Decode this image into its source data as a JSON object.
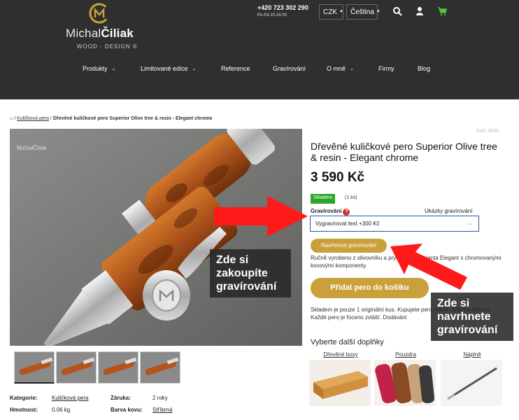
{
  "header": {
    "logo_first": "Michal",
    "logo_last": "Čiliak",
    "logo_sub": "WOOD - DESIGN ®",
    "phone": "+420 723 302 290",
    "hours": "Po-Pá 10-16:00",
    "currency": "CZK",
    "language": "Čeština",
    "nav": [
      {
        "label": "Produkty"
      },
      {
        "label": "Limitované edice"
      },
      {
        "label": "Reference"
      },
      {
        "label": "Gravírování"
      },
      {
        "label": "O mně"
      },
      {
        "label": "Firmy"
      },
      {
        "label": "Blog"
      }
    ]
  },
  "breadcrumb": {
    "category": "Kuličková pera",
    "separator": "/",
    "current": "Dřevěné kuličkové pero Superior Olive tree & resin - Elegant chrome"
  },
  "product": {
    "code": "Kód: 3633",
    "watermark": "MichalČiliak",
    "title": "Dřevěné kuličkové pero Superior Olive tree & resin - Elegant chrome",
    "price": "3 590 Kč",
    "stock_badge": "Skladem",
    "stock_qty": "(1 ks)",
    "engraving_label": "Gravírování",
    "engraving_help": "?",
    "engraving_preview_label": "Ukázky gravírování",
    "engraving_selected": "Vygravírovat text +300 Kč",
    "design_engraving_button": "Navrhnout gravírování",
    "description": "Ručně vyrobeno z olivovníku a pryskyřice - varianta Elegant s chromovanými kovovými komponenty.",
    "add_to_cart": "Přidat pero do košíku",
    "stock_note": "Skladem je pouze 1 originální kus. Kupujete pero, které vidíte na fotkách. Každé pero je foceno zvlášť. Dodávání",
    "more_accessories_title": "Vyberte další doplňky",
    "accessories": [
      {
        "label": "Dřevěné boxy"
      },
      {
        "label": "Pouzdra"
      },
      {
        "label": "Náplně"
      }
    ],
    "params": [
      {
        "key": "Kategorie:",
        "value": "Kuličková pera"
      },
      {
        "key": "Záruka:",
        "value": "2 roky"
      },
      {
        "key": "Hmotnost:",
        "value": "0.06 kg"
      },
      {
        "key": "Barva kovu:",
        "value": "Stříbrná"
      }
    ]
  },
  "annotations": {
    "buy_engraving": "Zde si zakoupíte gravírování",
    "design_engraving": "Zde si navrhnete gravírování"
  },
  "colors": {
    "header_bg": "#2f2f2f",
    "gold": "#caa03a",
    "stock_green": "#2aa52a",
    "arrow_red": "#ff1a1a"
  }
}
